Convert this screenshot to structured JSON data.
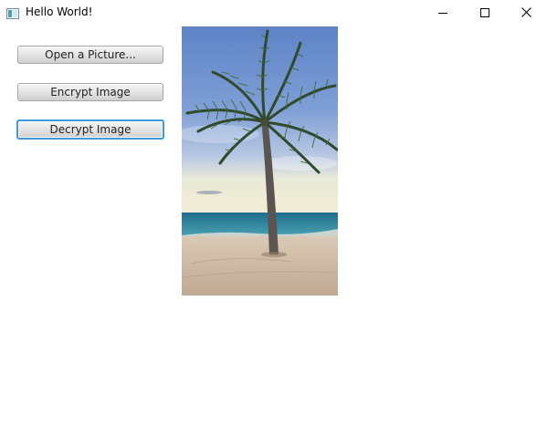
{
  "window": {
    "title": "Hello World!",
    "controls": {
      "minimize": "minimize-icon",
      "maximize": "maximize-icon",
      "close": "close-icon"
    }
  },
  "buttons": {
    "open": "Open a Picture...",
    "encrypt": "Encrypt Image",
    "decrypt": "Decrypt Image"
  },
  "focused_button": "decrypt",
  "colors": {
    "focus_ring": "#3e9ae0",
    "sky_top": "#5f86c8",
    "sea": "#2f7f9a",
    "sand": "#cbb8a3"
  }
}
